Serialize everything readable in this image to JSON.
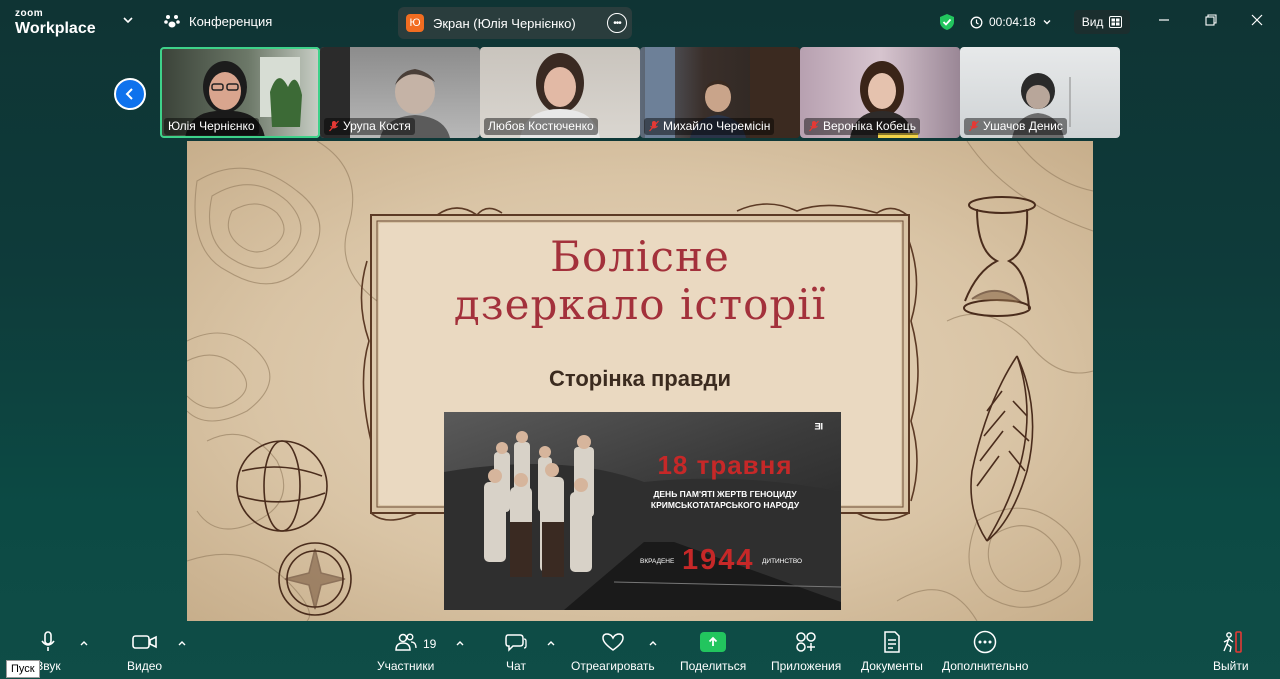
{
  "app": {
    "brand_top": "zoom",
    "brand_bottom": "Workplace"
  },
  "topbar": {
    "meeting_label": "Конференция",
    "screen_label": "Экран (Юлія Чернієнко)",
    "screen_avatar_letter": "Ю",
    "timer": "00:04:18",
    "view_label": "Вид"
  },
  "participants": [
    {
      "name": "Юлія Чернієнко",
      "muted": false,
      "active": true
    },
    {
      "name": "Урупа Костя",
      "muted": true
    },
    {
      "name": "Любов  Костюченко",
      "muted": false
    },
    {
      "name": "Михайло Черемісін",
      "muted": true
    },
    {
      "name": "Вероніка Кобець",
      "muted": true
    },
    {
      "name": "Ушачов Денис",
      "muted": true
    }
  ],
  "slide": {
    "title_line1": "Болісне",
    "title_line2": "дзеркало історії",
    "subtitle": "Сторінка правди",
    "poster": {
      "logo": "ᴲᴵ",
      "date": "18 травня",
      "line1": "ДЕНЬ ПАМ'ЯТІ ЖЕРТВ ГЕНОЦИДУ",
      "line2": "КРИМСЬКОТАТАРСЬКОГО НАРОДУ",
      "left_word": "ВКРАДЕНЕ",
      "year": "1944",
      "right_word": "ДИТИНСТВО"
    }
  },
  "toolbar": {
    "audio": "Звук",
    "video": "Видео",
    "participants": "Участники",
    "participants_count": "19",
    "chat": "Чат",
    "react": "Отреагировать",
    "share": "Поделиться",
    "apps": "Приложения",
    "docs": "Документы",
    "more": "Дополнительно",
    "leave": "Выйти"
  },
  "taskbar": {
    "start_tooltip": "Пуск"
  },
  "colors": {
    "accent_green": "#22c55e",
    "zoom_blue": "#0e72ed",
    "title_red": "#a3313b",
    "poster_red": "#c62828"
  }
}
